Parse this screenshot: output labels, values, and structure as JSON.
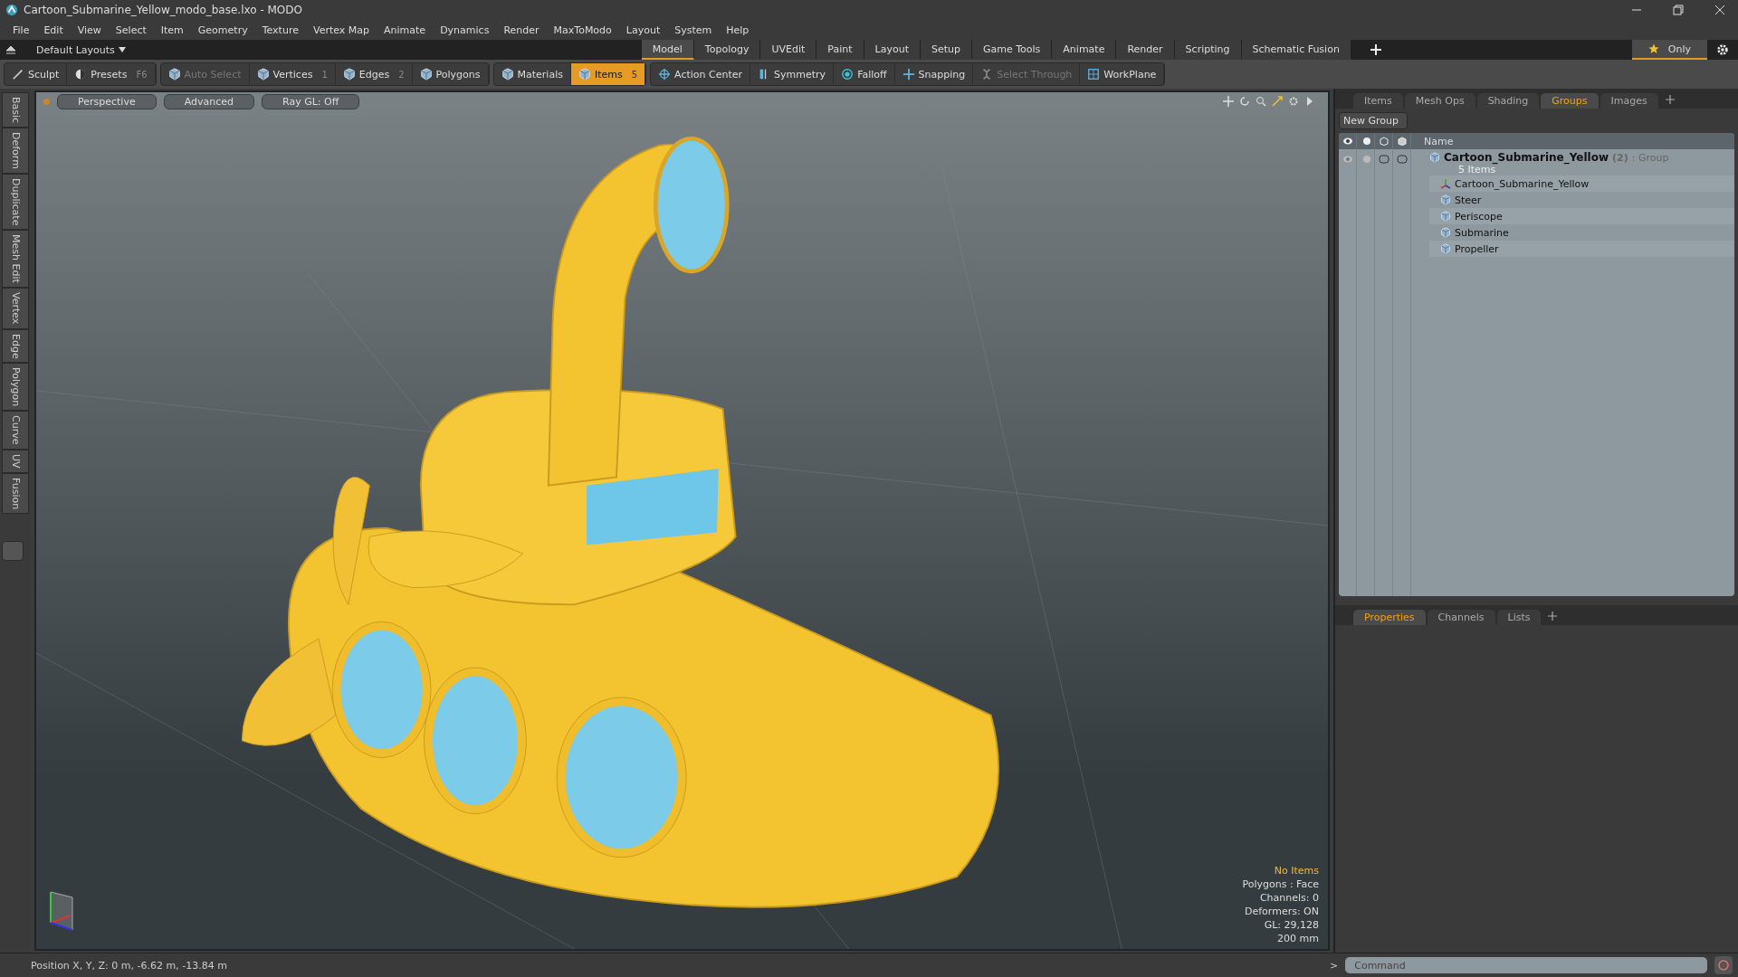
{
  "window": {
    "title": "Cartoon_Submarine_Yellow_modo_base.lxo - MODO"
  },
  "menu": [
    "File",
    "Edit",
    "View",
    "Select",
    "Item",
    "Geometry",
    "Texture",
    "Vertex Map",
    "Animate",
    "Dynamics",
    "Render",
    "MaxToModo",
    "Layout",
    "System",
    "Help"
  ],
  "layouts": {
    "label": "Default Layouts",
    "only_label": "Only",
    "tabs": [
      {
        "label": "Model",
        "selected": true
      },
      {
        "label": "Topology",
        "selected": false
      },
      {
        "label": "UVEdit",
        "selected": false
      },
      {
        "label": "Paint",
        "selected": false
      },
      {
        "label": "Layout",
        "selected": false
      },
      {
        "label": "Setup",
        "selected": false
      },
      {
        "label": "Game Tools",
        "selected": false
      },
      {
        "label": "Animate",
        "selected": false
      },
      {
        "label": "Render",
        "selected": false
      },
      {
        "label": "Scripting",
        "selected": false
      },
      {
        "label": "Schematic Fusion",
        "selected": false
      }
    ]
  },
  "toolbar": [
    {
      "buttons": [
        {
          "kind": "sculpt",
          "label": "Sculpt",
          "selected": false,
          "disabled": false
        },
        {
          "kind": "presets",
          "label": "Presets",
          "hint": "F6",
          "selected": false,
          "disabled": false
        }
      ]
    },
    {
      "buttons": [
        {
          "kind": "cube",
          "label": "Auto Select",
          "selected": false,
          "disabled": true
        },
        {
          "kind": "cube",
          "label": "Vertices",
          "hint": "1",
          "selected": false,
          "disabled": false
        },
        {
          "kind": "cube",
          "label": "Edges",
          "hint": "2",
          "selected": false,
          "disabled": false
        },
        {
          "kind": "cube",
          "label": "Polygons",
          "selected": false,
          "disabled": false
        }
      ]
    },
    {
      "buttons": [
        {
          "kind": "cube",
          "label": "Materials",
          "selected": false,
          "disabled": false
        },
        {
          "kind": "cube",
          "label": "Items",
          "hint": "5",
          "selected": true,
          "disabled": false
        }
      ]
    },
    {
      "buttons": [
        {
          "kind": "target",
          "label": "Action Center",
          "selected": false,
          "disabled": false
        },
        {
          "kind": "symmetry",
          "label": "Symmetry",
          "selected": false,
          "disabled": false
        },
        {
          "kind": "falloff",
          "label": "Falloff",
          "selected": false,
          "disabled": false
        },
        {
          "kind": "snapping",
          "label": "Snapping",
          "selected": false,
          "disabled": false
        },
        {
          "kind": "through",
          "label": "Select Through",
          "selected": false,
          "disabled": true
        },
        {
          "kind": "workplane",
          "label": "WorkPlane",
          "selected": false,
          "disabled": false
        }
      ]
    }
  ],
  "side_tabs": [
    "Basic",
    "Deform",
    "Duplicate",
    "Mesh Edit",
    "Vertex",
    "Edge",
    "Polygon",
    "Curve",
    "UV",
    "Fusion"
  ],
  "viewport": {
    "buttons": [
      "Perspective",
      "Advanced",
      "Ray GL: Off"
    ],
    "selection_info": "No Items",
    "info": [
      "Polygons : Face",
      "Channels: 0",
      "Deformers: ON",
      "GL: 29,128",
      "200 mm"
    ]
  },
  "item_panel": {
    "tabs": [
      {
        "label": "Items",
        "selected": false
      },
      {
        "label": "Mesh Ops",
        "selected": false
      },
      {
        "label": "Shading",
        "selected": false
      },
      {
        "label": "Groups",
        "selected": true
      },
      {
        "label": "Images",
        "selected": false
      }
    ],
    "new_group": "New Group",
    "name_column": "Name",
    "group": {
      "name": "Cartoon_Submarine_Yellow",
      "count": "(2)",
      "type": ": Group",
      "summary": "5 Items",
      "children": [
        {
          "name": "Cartoon_Submarine_Yellow",
          "kind": "locator"
        },
        {
          "name": "Steer",
          "kind": "mesh"
        },
        {
          "name": "Periscope",
          "kind": "mesh"
        },
        {
          "name": "Submarine",
          "kind": "mesh"
        },
        {
          "name": "Propeller",
          "kind": "mesh"
        }
      ]
    }
  },
  "properties_panel": {
    "tabs": [
      {
        "label": "Properties",
        "selected": true
      },
      {
        "label": "Channels",
        "selected": false
      },
      {
        "label": "Lists",
        "selected": false
      }
    ]
  },
  "status_bar": {
    "position": "Position X, Y, Z:   0 m, -6.62 m, -13.84 m",
    "command_prompt": ">",
    "command_placeholder": "Command"
  }
}
